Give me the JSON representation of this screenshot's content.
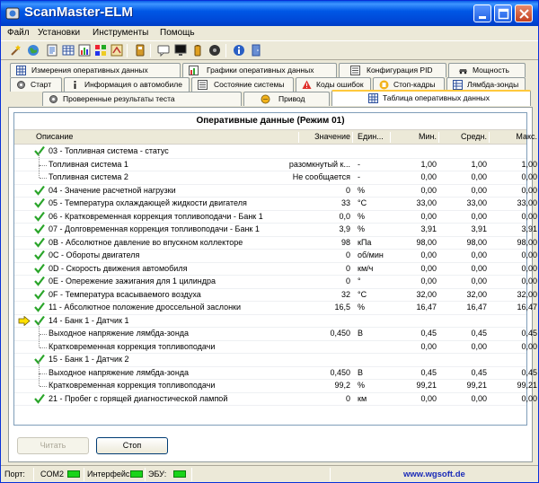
{
  "window": {
    "title": "ScanMaster-ELM"
  },
  "menu": [
    "Файл",
    "Установки",
    "Инструменты",
    "Помощь"
  ],
  "toolbar_icons": [
    "wizard-icon",
    "globe-icon",
    "document-icon",
    "table-icon",
    "chart-icon",
    "grid-icon",
    "speed-icon",
    "filter-icon",
    "chat-icon",
    "monitor-icon",
    "battery-icon",
    "disc-icon",
    "info-icon",
    "door-icon"
  ],
  "tabs": {
    "row1": [
      "Измерения оперативных данных",
      "Графики оперативных данных",
      "Конфигурация PID",
      "Мощность"
    ],
    "row2": [
      "Старт",
      "Информация о автомобиле",
      "Состояние системы",
      "Коды ошибок",
      "Стоп-кадры",
      "Лямбда-зонды"
    ],
    "row3": [
      "Проверенные результаты теста",
      "Привод",
      "Таблица оперативных данных"
    ]
  },
  "grid": {
    "title": "Оперативные данные (Режим 01)",
    "headers": {
      "desc": "Описание",
      "value": "Значение",
      "unit": "Един...",
      "min": "Мин.",
      "avg": "Средн.",
      "max": "Макс."
    },
    "rows": [
      {
        "desc": "03 - Топливная система - статус",
        "value": "",
        "unit": "",
        "min": "",
        "avg": "",
        "max": "",
        "type": "group"
      },
      {
        "desc": "Топливная система 1",
        "value": "разомкнутый к...",
        "unit": "-",
        "min": "1,00",
        "avg": "1,00",
        "max": "1,00",
        "type": "sub"
      },
      {
        "desc": "Топливная система 2",
        "value": "Не сообщается",
        "unit": "-",
        "min": "0,00",
        "avg": "0,00",
        "max": "0,00",
        "type": "sub"
      },
      {
        "desc": "04 - Значение расчетной нагрузки",
        "value": "0",
        "unit": "%",
        "min": "0,00",
        "avg": "0,00",
        "max": "0,00",
        "type": "item"
      },
      {
        "desc": "05 - Температура охлаждающей жидкости двигателя",
        "value": "33",
        "unit": "°C",
        "min": "33,00",
        "avg": "33,00",
        "max": "33,00",
        "type": "item"
      },
      {
        "desc": "06 - Кратковременная коррекция топливоподачи - Банк 1",
        "value": "0,0",
        "unit": "%",
        "min": "0,00",
        "avg": "0,00",
        "max": "0,00",
        "type": "item"
      },
      {
        "desc": "07 - Долговременная коррекция топливоподачи - Банк 1",
        "value": "3,9",
        "unit": "%",
        "min": "3,91",
        "avg": "3,91",
        "max": "3,91",
        "type": "item"
      },
      {
        "desc": "0B - Абсолютное давление во впускном коллекторе",
        "value": "98",
        "unit": "кПа",
        "min": "98,00",
        "avg": "98,00",
        "max": "98,00",
        "type": "item"
      },
      {
        "desc": "0C - Обороты двигателя",
        "value": "0",
        "unit": "об/мин",
        "min": "0,00",
        "avg": "0,00",
        "max": "0,00",
        "type": "item"
      },
      {
        "desc": "0D - Скорость движения автомобиля",
        "value": "0",
        "unit": "км/ч",
        "min": "0,00",
        "avg": "0,00",
        "max": "0,00",
        "type": "item"
      },
      {
        "desc": "0E - Опережение зажигания для 1 цилиндра",
        "value": "0",
        "unit": "°",
        "min": "0,00",
        "avg": "0,00",
        "max": "0,00",
        "type": "item"
      },
      {
        "desc": "0F - Температура всасываемого воздуха",
        "value": "32",
        "unit": "°C",
        "min": "32,00",
        "avg": "32,00",
        "max": "32,00",
        "type": "item"
      },
      {
        "desc": "11 - Абсолютное положение дроссельной заслонки",
        "value": "16,5",
        "unit": "%",
        "min": "16,47",
        "avg": "16,47",
        "max": "16,47",
        "type": "item"
      },
      {
        "desc": "14 - Банк 1 - Датчик 1",
        "value": "",
        "unit": "",
        "min": "",
        "avg": "",
        "max": "",
        "type": "group",
        "arrow": true
      },
      {
        "desc": "Выходное напряжение лямбда-зонда",
        "value": "0,450",
        "unit": "В",
        "min": "0,45",
        "avg": "0,45",
        "max": "0,45",
        "type": "sub"
      },
      {
        "desc": "Кратковременная коррекция топливоподачи",
        "value": "",
        "unit": "",
        "min": "0,00",
        "avg": "0,00",
        "max": "0,00",
        "type": "sub"
      },
      {
        "desc": "15 - Банк 1 - Датчик 2",
        "value": "",
        "unit": "",
        "min": "",
        "avg": "",
        "max": "",
        "type": "group"
      },
      {
        "desc": "Выходное напряжение лямбда-зонда",
        "value": "0,450",
        "unit": "В",
        "min": "0,45",
        "avg": "0,45",
        "max": "0,45",
        "type": "sub"
      },
      {
        "desc": "Кратковременная коррекция топливоподачи",
        "value": "99,2",
        "unit": "%",
        "min": "99,21",
        "avg": "99,21",
        "max": "99,21",
        "type": "sub"
      },
      {
        "desc": "21 - Пробег с горящей диагностической лампой",
        "value": "0",
        "unit": "км",
        "min": "0,00",
        "avg": "0,00",
        "max": "0,00",
        "type": "item"
      }
    ]
  },
  "buttons": {
    "read": "Читать",
    "stop": "Стоп"
  },
  "status": {
    "port_label": "Порт:",
    "port_value": "COM2",
    "interface_label": "Интерфейс:",
    "ecu_label": "ЭБУ:",
    "website": "www.wgsoft.de"
  },
  "colors": {
    "titlebar": "#0058e6",
    "led": "#19d419",
    "check": "#2aa52a",
    "tab_highlight": "#ffc83c",
    "link": "#1a2bb8"
  }
}
